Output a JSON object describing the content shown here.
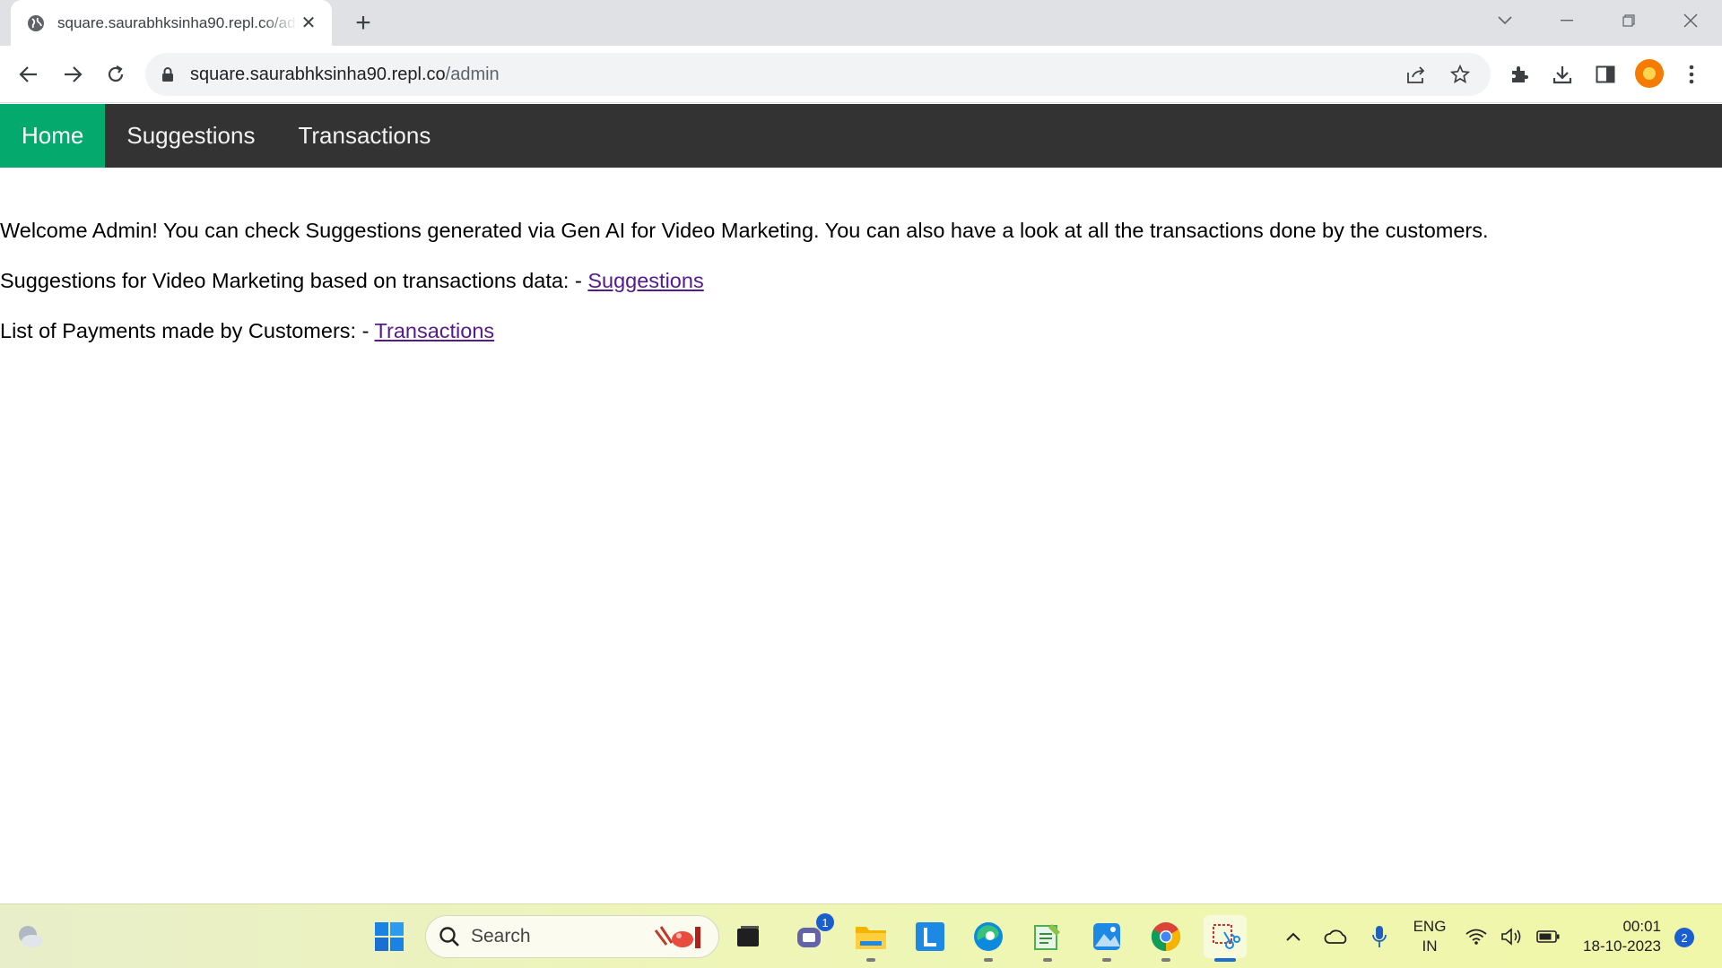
{
  "browser": {
    "tab_title": "square.saurabhksinha90.repl.co/admin",
    "url_host": "square.saurabhksinha90.repl.co",
    "url_path": "/admin"
  },
  "nav": {
    "home": "Home",
    "suggestions": "Suggestions",
    "transactions": "Transactions",
    "active_color": "#04aa6d",
    "bar_color": "#333333"
  },
  "content": {
    "welcome": "Welcome Admin! You can check Suggestions generated via Gen AI for Video Marketing. You can also have a look at all the transactions done by the customers.",
    "suggestions_prefix": "Suggestions for Video Marketing based on transactions data: - ",
    "suggestions_link": "Suggestions",
    "transactions_prefix": "List of Payments made by Customers: - ",
    "transactions_link": "Transactions"
  },
  "taskbar": {
    "search_label": "Search",
    "teams_badge": "1",
    "lang_line1": "ENG",
    "lang_line2": "IN",
    "time": "00:01",
    "date": "18-10-2023",
    "notification_count": "2"
  }
}
